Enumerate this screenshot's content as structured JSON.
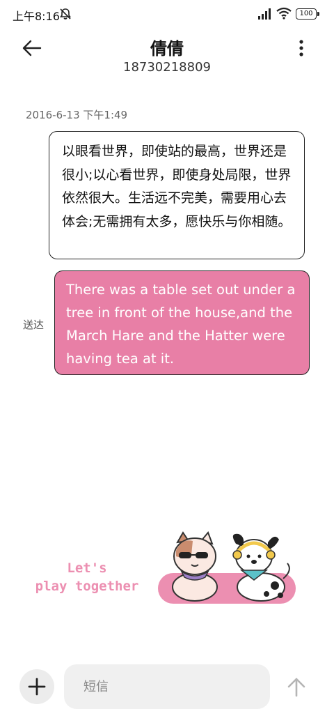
{
  "status_bar": {
    "time": "上午8:16",
    "battery": "100"
  },
  "header": {
    "title": "倩倩",
    "subtitle": "18730218809"
  },
  "conversation": {
    "timestamp": "2016-6-13 下午1:49",
    "messages": [
      {
        "direction": "incoming",
        "text": "以眼看世界，即使站的最高，世界还是很小;以心看世界，即使身处局限，世界依然很大。生活远不完美，需要用心去体会;无需拥有太多，愿快乐与你相随。"
      },
      {
        "direction": "outgoing",
        "status": "送达",
        "text": "There was a table set out under a tree in front of the house,and the March Hare and the Hatter were having tea at it."
      }
    ]
  },
  "sticker": {
    "line1": "Let's",
    "line2": "play together"
  },
  "composer": {
    "placeholder": "短信"
  },
  "colors": {
    "outgoing_bubble": "#e87fa6",
    "sticker_pink": "#ec8fb1"
  },
  "icons": [
    "mute-bell-icon",
    "signal-icon",
    "wifi-icon",
    "back-arrow-icon",
    "more-vertical-icon",
    "plus-icon",
    "send-arrow-icon"
  ]
}
